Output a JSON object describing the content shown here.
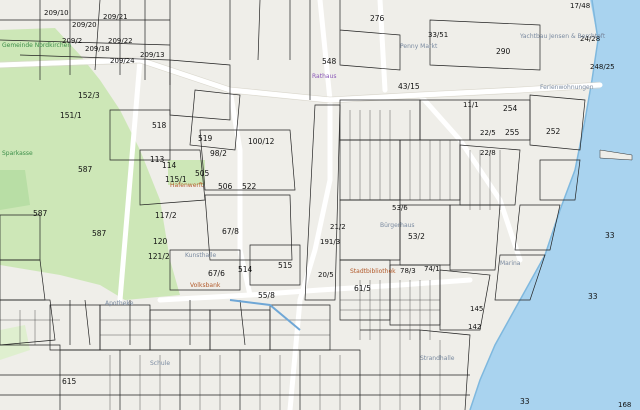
{
  "map": {
    "colors": {
      "water": "#a9d3ef",
      "shore": "#7fb8de",
      "park": "#cde7b7",
      "land": "#efeee9",
      "parcel_line": "#222222",
      "road": "#ffffff"
    },
    "parcels": [
      {
        "id": "p1",
        "text": "209/10"
      },
      {
        "id": "p2",
        "text": "209/21"
      },
      {
        "id": "p3",
        "text": "209/20"
      },
      {
        "id": "p4",
        "text": "209/2"
      },
      {
        "id": "p5",
        "text": "209/22"
      },
      {
        "id": "p6",
        "text": "209/18"
      },
      {
        "id": "p7",
        "text": "209/24"
      },
      {
        "id": "p8",
        "text": "209/13"
      },
      {
        "id": "p9",
        "text": "152/3"
      },
      {
        "id": "p10",
        "text": "151/1"
      },
      {
        "id": "p11",
        "text": "518"
      },
      {
        "id": "p12",
        "text": "519"
      },
      {
        "id": "p13",
        "text": "98/2"
      },
      {
        "id": "p14",
        "text": "113"
      },
      {
        "id": "p15",
        "text": "114"
      },
      {
        "id": "p16",
        "text": "115/1"
      },
      {
        "id": "p17",
        "text": "587"
      },
      {
        "id": "p18",
        "text": "587"
      },
      {
        "id": "p19",
        "text": "117/2"
      },
      {
        "id": "p20",
        "text": "120"
      },
      {
        "id": "p21",
        "text": "121/2"
      },
      {
        "id": "p22",
        "text": "587"
      },
      {
        "id": "p23",
        "text": "100/12"
      },
      {
        "id": "p24",
        "text": "505"
      },
      {
        "id": "p25",
        "text": "506"
      },
      {
        "id": "p26",
        "text": "522"
      },
      {
        "id": "p27",
        "text": "67/8"
      },
      {
        "id": "p28",
        "text": "67/6"
      },
      {
        "id": "p29",
        "text": "514"
      },
      {
        "id": "p30",
        "text": "515"
      },
      {
        "id": "p31",
        "text": "55/8"
      },
      {
        "id": "p32",
        "text": "548"
      },
      {
        "id": "p33",
        "text": "43/15"
      },
      {
        "id": "p34",
        "text": "290"
      },
      {
        "id": "p35",
        "text": "254"
      },
      {
        "id": "p36",
        "text": "255"
      },
      {
        "id": "p37",
        "text": "252"
      },
      {
        "id": "p38",
        "text": "53/2"
      },
      {
        "id": "p39",
        "text": "61/5"
      },
      {
        "id": "p40",
        "text": "33"
      },
      {
        "id": "p41",
        "text": "33"
      },
      {
        "id": "p42",
        "text": "33"
      },
      {
        "id": "p43",
        "text": "615"
      },
      {
        "id": "p44",
        "text": "276"
      },
      {
        "id": "p45",
        "text": "17/48"
      },
      {
        "id": "p46",
        "text": "24/28"
      },
      {
        "id": "p47",
        "text": "248/25"
      },
      {
        "id": "p48",
        "text": "22/8"
      },
      {
        "id": "p49",
        "text": "11/1"
      },
      {
        "id": "p50",
        "text": "33/51"
      },
      {
        "id": "p51",
        "text": "22/5"
      },
      {
        "id": "p52",
        "text": "21/2"
      },
      {
        "id": "p53",
        "text": "191/3"
      },
      {
        "id": "p54",
        "text": "20/5"
      },
      {
        "id": "p55",
        "text": "53/6"
      },
      {
        "id": "p56",
        "text": "74/1"
      },
      {
        "id": "p57",
        "text": "78/3"
      },
      {
        "id": "p58",
        "text": "145"
      },
      {
        "id": "p59",
        "text": "142"
      },
      {
        "id": "p60",
        "text": "168"
      }
    ],
    "pois": [
      {
        "id": "poi1",
        "text": "Gemeinde Nordkirchen"
      },
      {
        "id": "poi2",
        "text": "Sparkasse"
      },
      {
        "id": "poi3",
        "text": "Penny Markt"
      },
      {
        "id": "poi4",
        "text": "Yachtbau Jensen & Berchtoft"
      },
      {
        "id": "poi5",
        "text": "Ferienwohnungen"
      },
      {
        "id": "poi6",
        "text": "Rathaus"
      },
      {
        "id": "poi7",
        "text": "Hafenwerft"
      },
      {
        "id": "poi8",
        "text": "Kunsthalle"
      },
      {
        "id": "poi9",
        "text": "Stadtbibliothek"
      },
      {
        "id": "poi10",
        "text": "Bürgerhaus"
      },
      {
        "id": "poi11",
        "text": "Volksbank"
      },
      {
        "id": "poi12",
        "text": "Apotheke"
      },
      {
        "id": "poi13",
        "text": "Schule"
      },
      {
        "id": "poi14",
        "text": "Strandhalle"
      },
      {
        "id": "poi15",
        "text": "Marina"
      }
    ]
  }
}
